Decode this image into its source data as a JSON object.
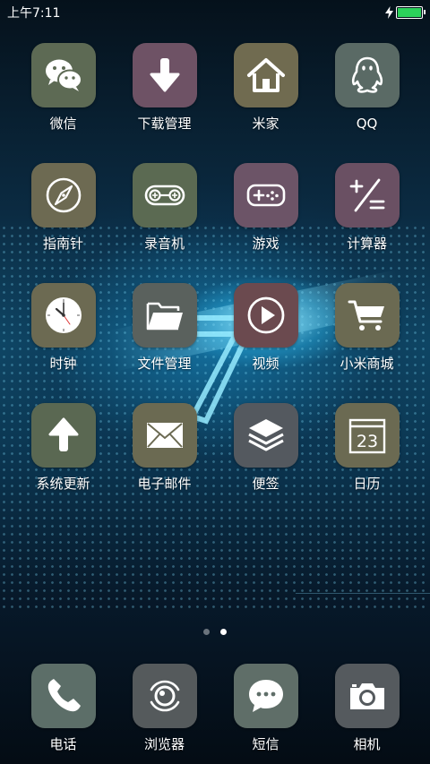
{
  "status_bar": {
    "time": "上午7:11",
    "battery_color": "#2bd15a",
    "charging_icon": "lightning-icon"
  },
  "apps": [
    {
      "label": "微信",
      "icon": "wechat-icon",
      "color": "#5d6a54"
    },
    {
      "label": "下载管理",
      "icon": "download-arrow-icon",
      "color": "#6e5265"
    },
    {
      "label": "米家",
      "icon": "home-icon",
      "color": "#706b50"
    },
    {
      "label": "QQ",
      "icon": "penguin-icon",
      "color": "#5a6a65"
    },
    {
      "label": "指南针",
      "icon": "compass-icon",
      "color": "#6d6a52"
    },
    {
      "label": "录音机",
      "icon": "tape-recorder-icon",
      "color": "#5b6a52"
    },
    {
      "label": "游戏",
      "icon": "gamepad-icon",
      "color": "#6c5467"
    },
    {
      "label": "计算器",
      "icon": "calculator-icon",
      "color": "#6a5063"
    },
    {
      "label": "时钟",
      "icon": "clock-icon",
      "color": "#6c6a52"
    },
    {
      "label": "文件管理",
      "icon": "folder-icon",
      "color": "#5a615d"
    },
    {
      "label": "视频",
      "icon": "play-icon",
      "color": "#6b4a4f"
    },
    {
      "label": "小米商城",
      "icon": "cart-icon",
      "color": "#6b6a52"
    },
    {
      "label": "系统更新",
      "icon": "upload-arrow-icon",
      "color": "#5a6852"
    },
    {
      "label": "电子邮件",
      "icon": "envelope-icon",
      "color": "#6b6a52"
    },
    {
      "label": "便签",
      "icon": "layers-icon",
      "color": "#54595f"
    },
    {
      "label": "日历",
      "icon": "calendar-icon",
      "color": "#6b6a52",
      "day": "23"
    }
  ],
  "pager": {
    "current": 2,
    "total": 2
  },
  "dock": [
    {
      "label": "电话",
      "icon": "phone-icon",
      "color": "#5c6e68"
    },
    {
      "label": "浏览器",
      "icon": "browser-icon",
      "color": "#555a5c"
    },
    {
      "label": "短信",
      "icon": "message-bubble-icon",
      "color": "#5f6e68"
    },
    {
      "label": "相机",
      "icon": "camera-icon",
      "color": "#555a5e"
    }
  ]
}
